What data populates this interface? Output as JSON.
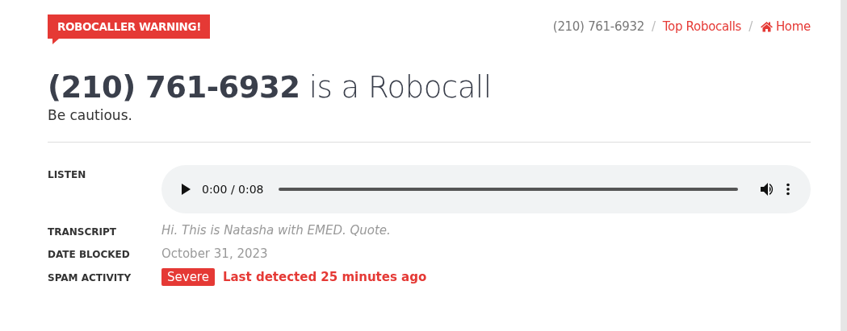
{
  "badge": "ROBOCALLER WARNING!",
  "breadcrumbs": [
    {
      "label": "(210) 761-6932",
      "kind": "current"
    },
    {
      "label": "/",
      "kind": "sep"
    },
    {
      "label": "Top Robocalls",
      "kind": "link"
    },
    {
      "label": "/",
      "kind": "sep"
    },
    {
      "label": "Home",
      "kind": "home"
    }
  ],
  "heading": {
    "number": "(210) 761-6932",
    "rest": "is a Robocall"
  },
  "subtitle": "Be cautious.",
  "details": [
    {
      "label": "LISTEN",
      "kind": "audio",
      "time": "0:00 / 0:08"
    },
    {
      "label": "TRANSCRIPT",
      "kind": "quote",
      "value": "Hi. This is Natasha with EMED. Quote."
    },
    {
      "label": "DATE BLOCKED",
      "kind": "text",
      "value": "October 31, 2023"
    },
    {
      "label": "SPAM ACTIVITY",
      "kind": "activity",
      "tag": "Severe",
      "value": "Last detected 25 minutes ago"
    }
  ]
}
